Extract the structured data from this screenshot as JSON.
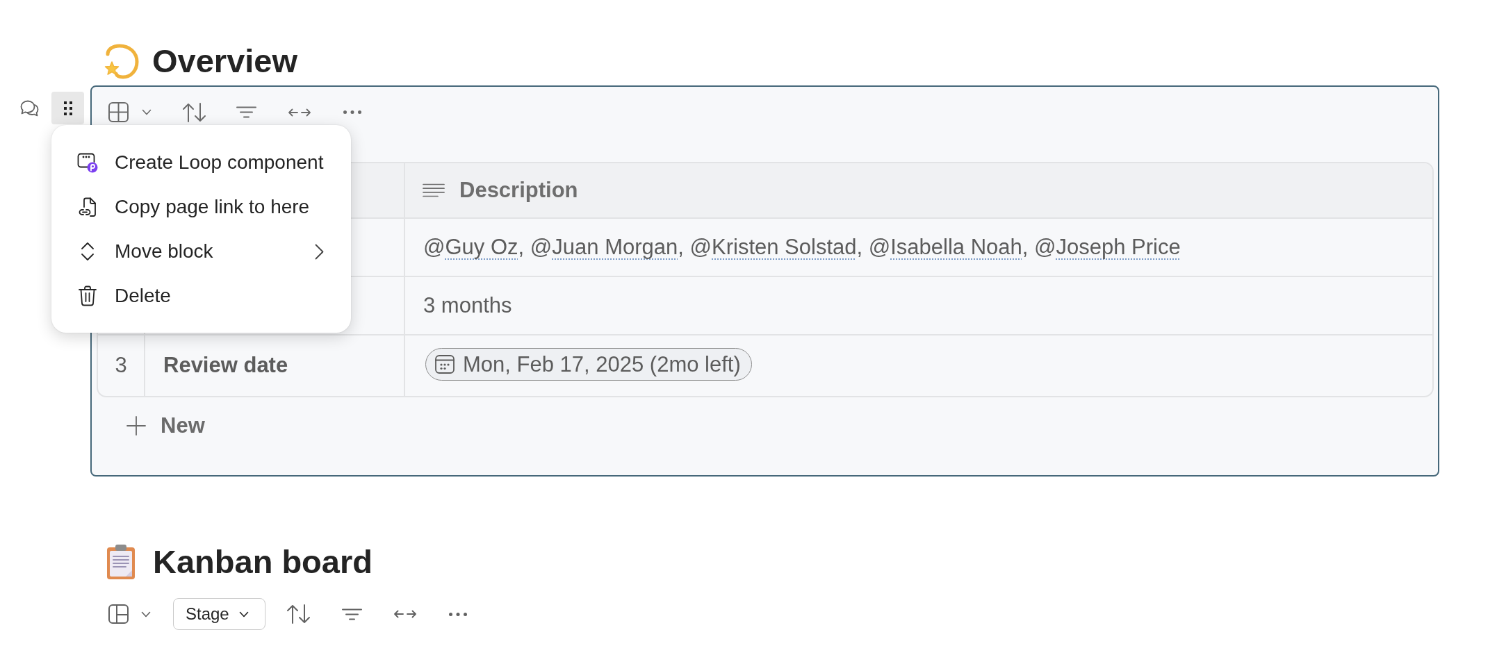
{
  "overview": {
    "title": "Overview",
    "table": {
      "columns": [
        {
          "label": "Description"
        }
      ],
      "rows": [
        {
          "description": {
            "kind": "mentions",
            "mentions": [
              {
                "symbol": "@",
                "name": "Guy Oz"
              },
              {
                "symbol": "@",
                "name": "Juan Morgan"
              },
              {
                "symbol": "@",
                "name": "Kristen Solstad"
              },
              {
                "symbol": "@",
                "name": "Isabella Noah"
              },
              {
                "symbol": "@",
                "name": "Joseph Price"
              }
            ],
            "separator": ","
          }
        },
        {
          "description": {
            "kind": "text",
            "text": "3 months"
          }
        },
        {
          "number": "3",
          "name": "Review date",
          "description": {
            "kind": "date",
            "text": "Mon, Feb 17, 2025 (2mo left)"
          }
        }
      ]
    },
    "new_row": "New"
  },
  "block_menu": {
    "items": [
      {
        "kind": "create",
        "label": "Create Loop component",
        "submenu": false
      },
      {
        "kind": "link",
        "label": "Copy page link to here",
        "submenu": false
      },
      {
        "kind": "move",
        "label": "Move block",
        "submenu": true
      },
      {
        "kind": "delete",
        "label": "Delete",
        "submenu": false
      }
    ]
  },
  "kanban": {
    "title": "Kanban board",
    "group_by": "Stage"
  }
}
